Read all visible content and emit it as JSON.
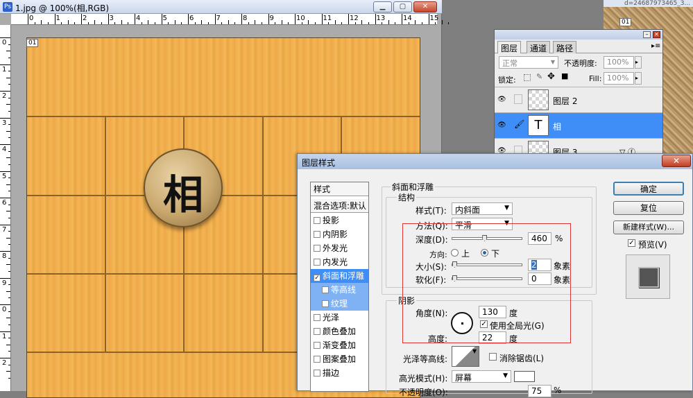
{
  "doc": {
    "title": "1.jpg @ 100%(相,RGB)",
    "tag": "01",
    "hruler": [
      "0",
      "1",
      "2",
      "3",
      "4",
      "5",
      "6",
      "7",
      "8",
      "9",
      "10",
      "11",
      "12",
      "13",
      "14",
      "15"
    ],
    "vruler": [
      "0",
      "1",
      "2",
      "3",
      "4",
      "5",
      "6",
      "7",
      "8",
      "9",
      "0",
      "1",
      "2"
    ]
  },
  "bgwin": {
    "title": "d=24687973465_3...",
    "tag": "01"
  },
  "piece": {
    "char": "相"
  },
  "layers": {
    "tabs": [
      "图层",
      "通道",
      "路径"
    ],
    "blend": "正常",
    "opacity_label": "不透明度:",
    "opacity": "100%",
    "lock_label": "锁定:",
    "fill_label": "Fill:",
    "fill": "100%",
    "rows": [
      {
        "name": "图层 2"
      },
      {
        "name": "相",
        "thumb": "T"
      },
      {
        "name": "图层 3"
      }
    ]
  },
  "dialog": {
    "title": "图层样式",
    "close": "✕",
    "styles_header": "样式",
    "blend_options": "混合选项:默认",
    "items": [
      {
        "label": "投影",
        "checked": false
      },
      {
        "label": "内阴影",
        "checked": false
      },
      {
        "label": "外发光",
        "checked": false
      },
      {
        "label": "内发光",
        "checked": false
      },
      {
        "label": "斜面和浮雕",
        "checked": true
      },
      {
        "label": "等高线",
        "checked": false
      },
      {
        "label": "纹理",
        "checked": false
      },
      {
        "label": "光泽",
        "checked": false
      },
      {
        "label": "颜色叠加",
        "checked": false
      },
      {
        "label": "渐变叠加",
        "checked": false
      },
      {
        "label": "图案叠加",
        "checked": false
      },
      {
        "label": "描边",
        "checked": false
      }
    ],
    "bevel": {
      "title": "斜面和浮雕",
      "structure": "结构",
      "style_label": "样式(T):",
      "style": "内斜面",
      "technique_label": "方法(Q):",
      "technique": "平滑",
      "depth_label": "深度(D):",
      "depth": "460",
      "depth_unit": "%",
      "depth_level": 0.46,
      "direction_label": "方向:",
      "up": "上",
      "down": "下",
      "size_label": "大小(S):",
      "size": "2",
      "size_unit": "象素",
      "soften_label": "软化(F):",
      "soften": "0",
      "soften_unit": "象素"
    },
    "shading": {
      "title": "阴影",
      "angle_label": "角度(N):",
      "angle": "130",
      "angle_unit": "度",
      "global_light": "使用全局光(G)",
      "altitude_label": "高度:",
      "altitude": "22",
      "altitude_unit": "度",
      "gloss_label": "光泽等高线:",
      "antialias": "消除锯齿(L)",
      "hl_mode_label": "高光模式(H):",
      "hl_mode": "屏幕",
      "opacity_label": "不透明度(O):",
      "opacity": "75",
      "opacity_unit": "%"
    },
    "buttons": {
      "ok": "确定",
      "reset": "复位",
      "new_style": "新建样式(W)...",
      "preview": "预览(V)"
    }
  }
}
